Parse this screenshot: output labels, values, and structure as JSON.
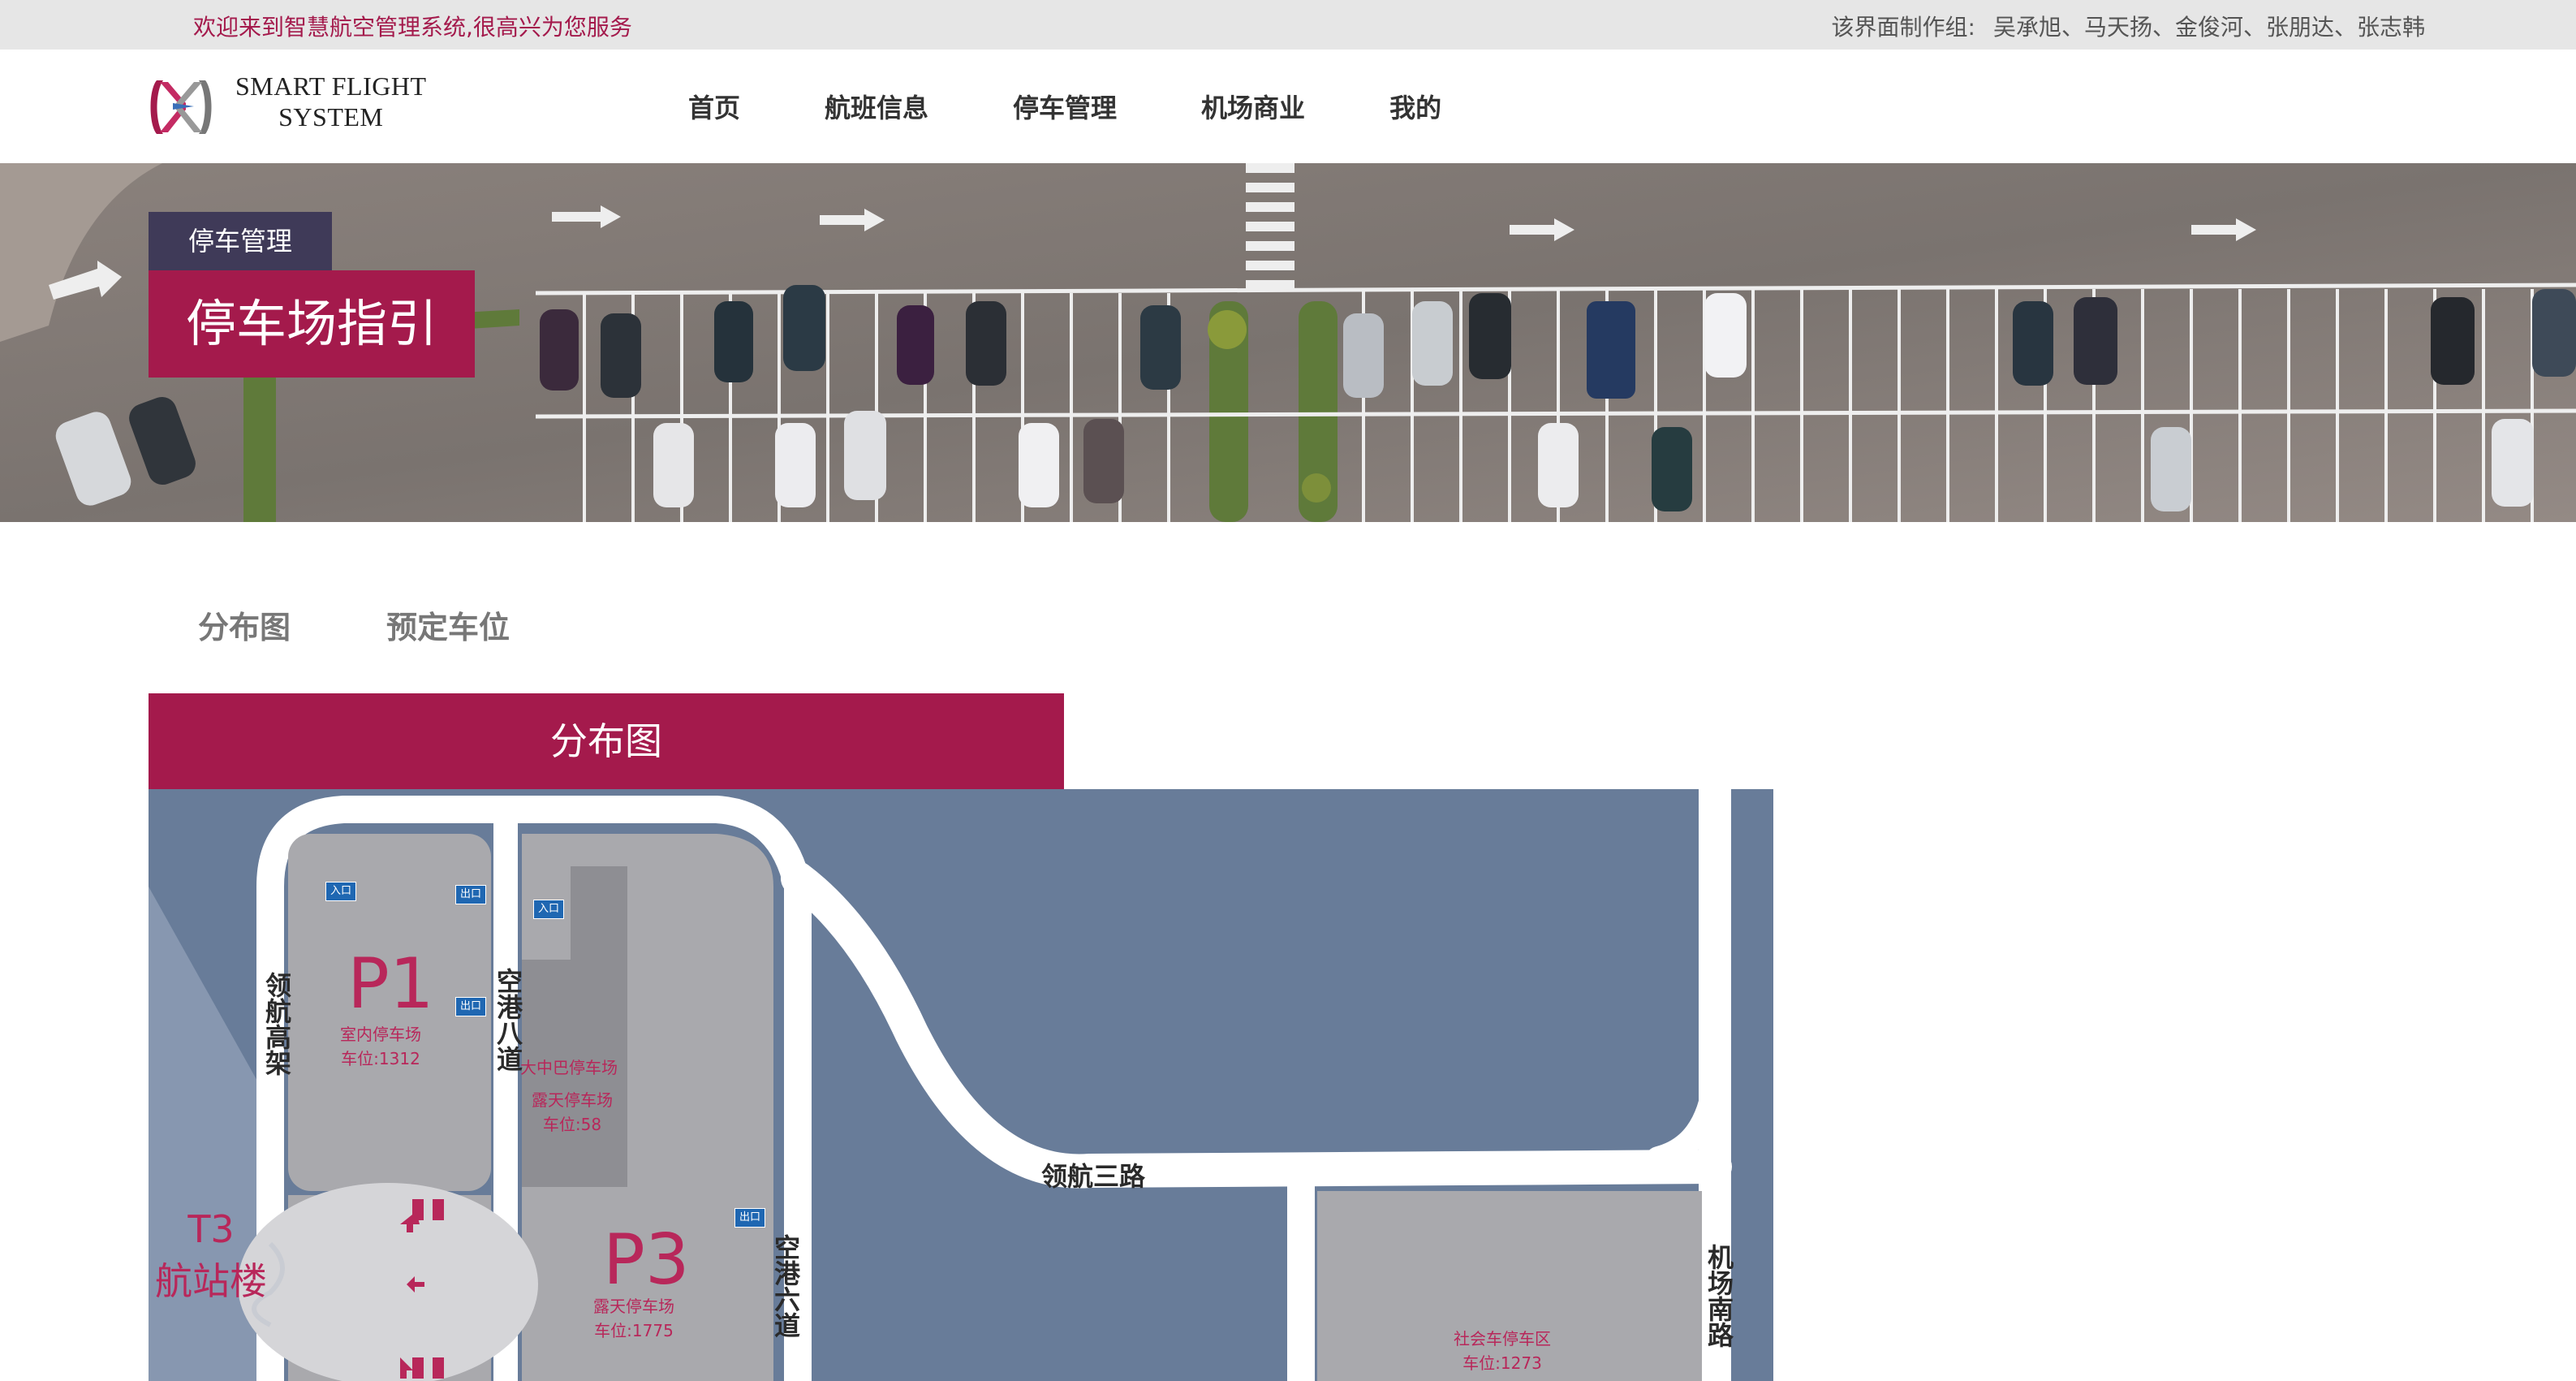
{
  "topbar": {
    "welcome": "欢迎来到智慧航空管理系统,很高兴为您服务",
    "credits_label": "该界面制作组:",
    "credits_names": "吴承旭、马天扬、金俊河、张朋达、张志韩"
  },
  "header": {
    "logo_line1": "SMART FLIGHT",
    "logo_line2": "SYSTEM",
    "nav": [
      "首页",
      "航班信息",
      "停车管理",
      "机场商业",
      "我的"
    ]
  },
  "banner": {
    "breadcrumb": "停车管理",
    "title": "停车场指引"
  },
  "tabs": [
    "分布图",
    "预定车位"
  ],
  "section": {
    "title": "分布图"
  },
  "map": {
    "p1": {
      "code": "P1",
      "type": "室内停车场",
      "spaces": "车位:1312"
    },
    "bus": {
      "name": "大中巴停车场"
    },
    "open": {
      "type": "露天停车场",
      "spaces": "车位:58"
    },
    "p3": {
      "code": "P3",
      "type": "露天停车场",
      "spaces": "车位:1775"
    },
    "social": {
      "type": "社会车停车区",
      "spaces": "车位:1273"
    },
    "terminal": {
      "line1": "T3",
      "line2": "航站楼"
    },
    "roads": {
      "linghang_elevated": "领航高架",
      "konggang_8": "空港八道",
      "konggang_6": "空港六道",
      "linghang_3": "领航三路",
      "jichang_south": "机场南路"
    },
    "signs": {
      "entrance": "入口",
      "exit": "出口"
    }
  },
  "colors": {
    "accent": "#a41a4c",
    "breadcrumb_bg": "#3f3a58",
    "map_bg": "#687c99"
  }
}
